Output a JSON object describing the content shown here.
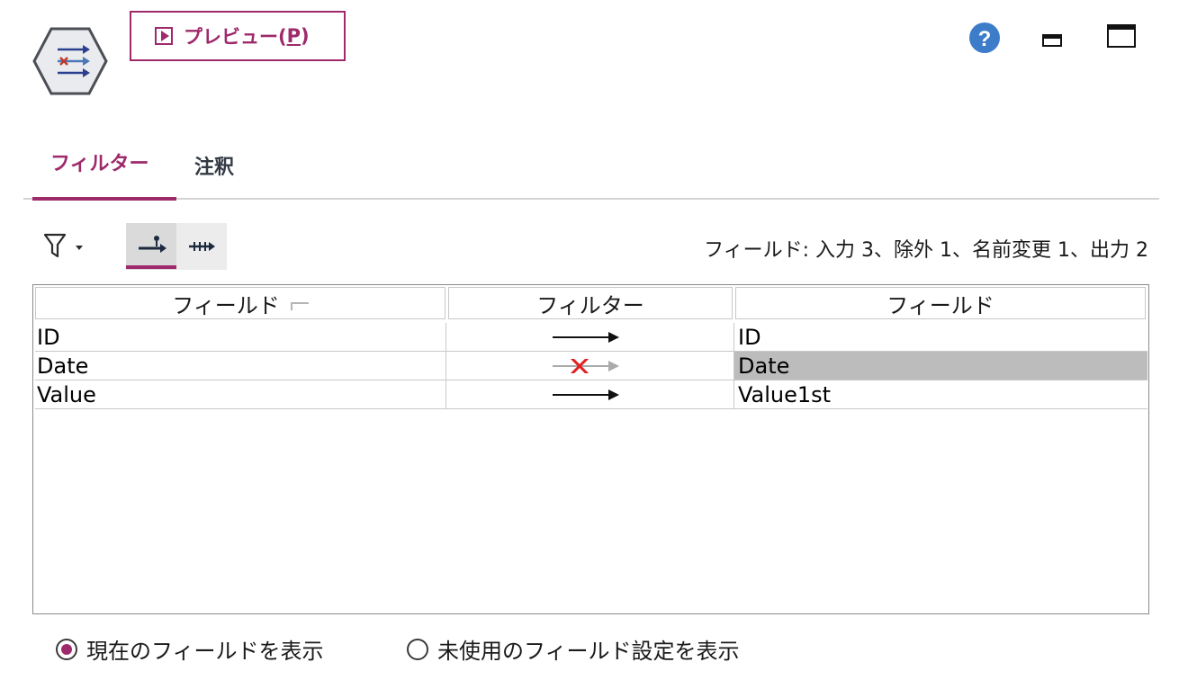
{
  "header": {
    "preview_label": "プレビュー(",
    "preview_mnemonic": "P",
    "preview_close": ")"
  },
  "tabs": [
    {
      "label": "フィルター",
      "active": true
    },
    {
      "label": "注釈",
      "active": false
    }
  ],
  "toolbar": {
    "summary": "フィールド: 入力 3、除外 1、名前変更 1、出力 2"
  },
  "table": {
    "headers": [
      "フィールド",
      "フィルター",
      "フィールド"
    ],
    "rows": [
      {
        "input": "ID",
        "filter": "pass",
        "output": "ID",
        "selected": false
      },
      {
        "input": "Date",
        "filter": "excluded",
        "output": "Date",
        "selected": true
      },
      {
        "input": "Value",
        "filter": "pass",
        "output": "Value1st",
        "selected": false
      }
    ]
  },
  "view_options": {
    "current_label": "現在のフィールドを表示",
    "unused_label": "未使用のフィールド設定を表示",
    "selected": "current"
  },
  "colors": {
    "accent": "#9e2a6c",
    "help": "#3d7cc9",
    "selected_cell": "#bcbcbc"
  }
}
